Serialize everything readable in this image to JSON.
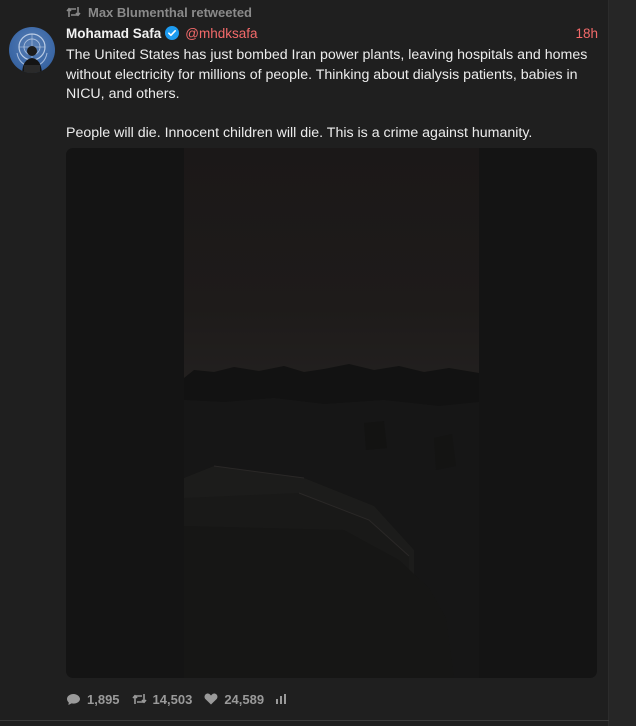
{
  "retweet_context": {
    "label": "Max Blumenthal retweeted"
  },
  "author": {
    "name": "Mohamad Safa",
    "handle": "@mhdksafa",
    "verified": true
  },
  "timestamp": "18h",
  "tweet": {
    "paragraphs": [
      "The United States has just bombed Iran power plants, leaving hospitals and homes without electricity for millions of people. Thinking about dialysis patients, babies in NICU, and others.",
      "People will die. Innocent children will die. This is a crime against humanity."
    ]
  },
  "stats": {
    "replies": "1,895",
    "retweets": "14,503",
    "likes": "24,589"
  },
  "icons": {
    "retweet_context": "retweet-icon",
    "verified": "verified-badge-icon",
    "reply": "reply-icon",
    "retweet": "retweet-icon",
    "like": "heart-icon",
    "analytics": "bar-chart-icon"
  },
  "colors": {
    "accent": "#f36a6a",
    "verified": "#1d9bf0",
    "background": "#1f1f1f"
  }
}
